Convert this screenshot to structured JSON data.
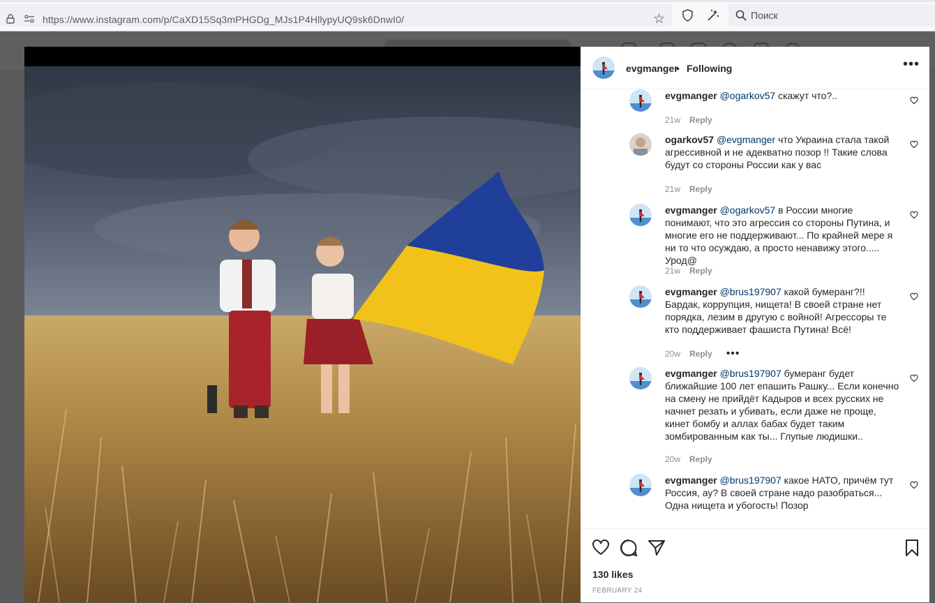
{
  "browser": {
    "url": "https://www.instagram.com/p/CaXD15Sq3mPHGDg_MJs1P4HllypyUQ9sk6DnwI0/",
    "search_placeholder": "Поиск"
  },
  "post": {
    "username": "evgmanger",
    "separator": "•",
    "follow_status": "Following",
    "more_label": "•••",
    "likes": "130 likes",
    "date": "FEBRUARY 24"
  },
  "comments": [
    {
      "user": "evgmanger",
      "mention": "@ogarkov57",
      "text": " скажут что?..",
      "time": "21w",
      "reply": "Reply"
    },
    {
      "user": "ogarkov57",
      "mention": "@evgmanger",
      "text": " что Украина стала такой агрессивной и не адекватно позор !! Такие слова будут со стороны России как у вас",
      "time": "21w",
      "reply": "Reply"
    },
    {
      "user": "evgmanger",
      "mention": "@ogarkov57",
      "text": " в России многие понимают, что это агрессия со стороны Путина, и многие его не поддерживают... По крайней мере я ни то что осуждаю, а просто ненавижу этого..... Урод@",
      "time": "21w",
      "reply": "Reply"
    },
    {
      "user": "evgmanger",
      "mention": "@brus197907",
      "text": " какой бумеранг?!! Бардак, коррупция, нищета! В своей стране нет порядка, лезим в другую с войной! Агрессоры те кто поддерживает фашиста Путина! Всё!",
      "time": "20w",
      "reply": "Reply",
      "more": "•••"
    },
    {
      "user": "evgmanger",
      "mention": "@brus197907",
      "text": " бумеранг будет ближайшие 100 лет епашить Рашку... Если конечно на смену не прийдёт Кадыров и всех русских не начнет резать и убивать, если даже не проще, кинет бомбу и аллах бабах будет таким зомбированным как ты... Глупые людишки..",
      "time": "20w",
      "reply": "Reply"
    },
    {
      "user": "evgmanger",
      "mention": "@brus197907",
      "text": " какое НАТО, причём тут Россия, ау? В своей стране надо разобраться... Одна нищета и убогость! Позор",
      "time": "20w",
      "reply": "Reply"
    }
  ],
  "colors": {
    "flag_blue": "#1f3f9a",
    "flag_yellow": "#f2c21a",
    "text": "#262626",
    "mention": "#00376b",
    "muted": "#8e8e8e"
  }
}
